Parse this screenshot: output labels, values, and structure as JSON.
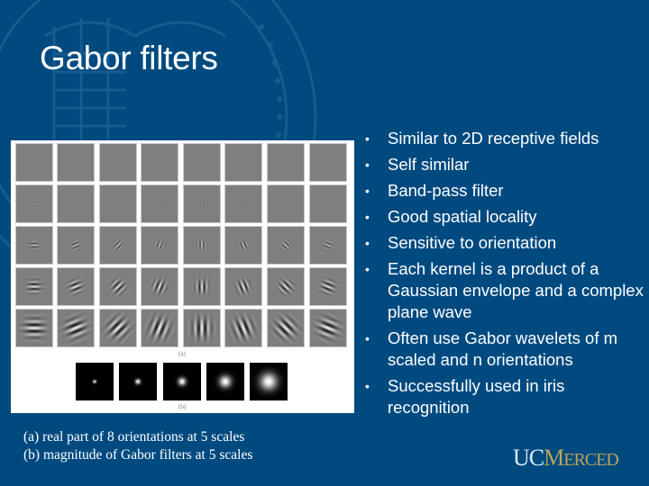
{
  "slide": {
    "title": "Gabor filters",
    "background_color": "#004a80",
    "bullets": [
      "Similar to 2D receptive fields",
      "Self similar",
      "Band-pass filter",
      "Good spatial locality",
      "Sensitive to orientation",
      "Each kernel is a product of a Gaussian envelope and a complex plane wave",
      "Often use Gabor wavelets of m scaled and n orientations",
      "Successfully used in iris recognition"
    ],
    "bullet_glyph": "•",
    "figure": {
      "label_a": "(a)",
      "label_b": "(b)",
      "orientations": 8,
      "scales": 5
    },
    "caption": {
      "line_a": "(a) real part of 8 orientations at 5 scales",
      "line_b": "(b) magnitude of Gabor filters at 5 scales"
    },
    "logo": {
      "uc": "UC",
      "merced_initial": "M",
      "merced_rest": "ERCED",
      "uc_color": "#d8ecf5",
      "merced_color": "#b9a45a"
    }
  }
}
